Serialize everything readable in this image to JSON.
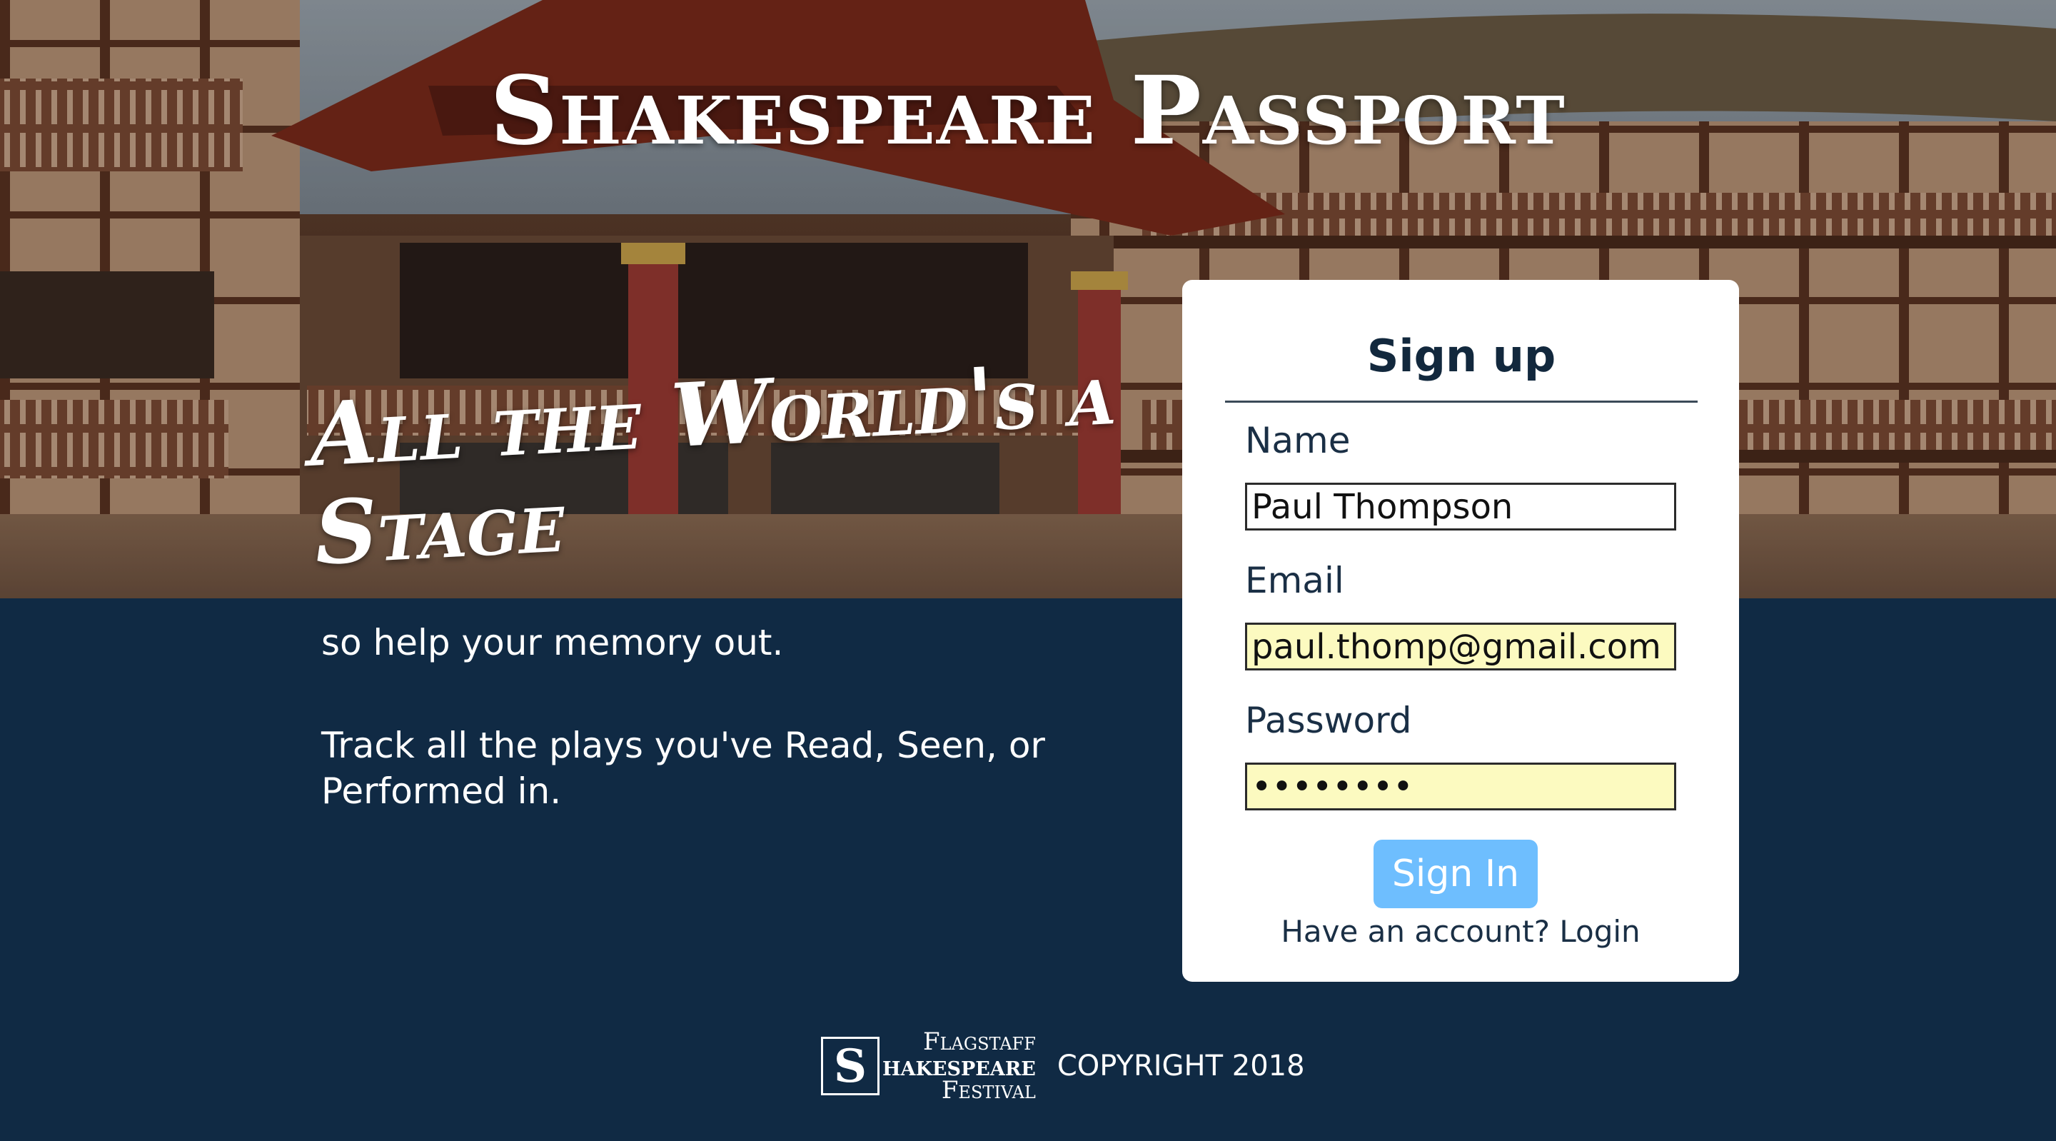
{
  "header": {
    "app_title": "Shakespeare Passport"
  },
  "hero": {
    "tagline_line1": "All the World's a",
    "tagline_line2": "Stage"
  },
  "body": {
    "paragraph1": "so help your memory out.",
    "paragraph2": "Track all the plays you've Read, Seen, or Performed in."
  },
  "signup_form": {
    "title": "Sign up",
    "name_label": "Name",
    "name_value": "Paul Thompson",
    "email_label": "Email",
    "email_value": "paul.thomp@gmail.com",
    "password_label": "Password",
    "password_value": "••••••••",
    "submit_label": "Sign In",
    "have_account_text": "Have an account?",
    "login_link": "Login"
  },
  "footer": {
    "logo_initial": "S",
    "logo_line1": "Flagstaff",
    "logo_line2": "hakespeare",
    "logo_line3": "Festival",
    "copyright": "COPYRIGHT 2018"
  },
  "colors": {
    "page_background": "#102a44",
    "card_background": "#ffffff",
    "button_background": "#6ebefe",
    "autofill_background": "#fcfac0",
    "text_dark": "#12283d"
  }
}
